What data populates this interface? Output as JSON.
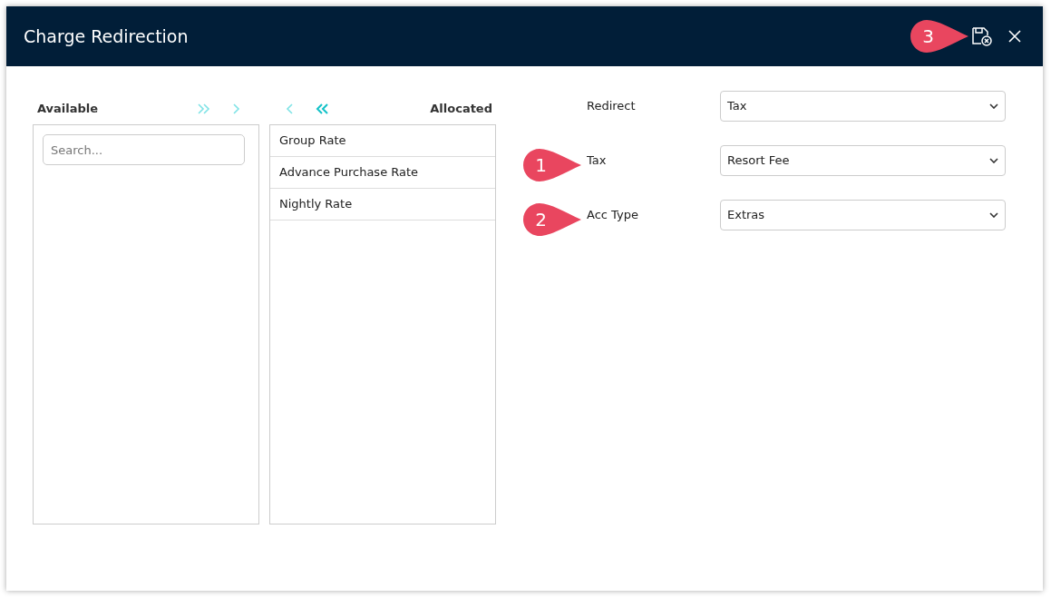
{
  "window": {
    "title": "Charge Redirection"
  },
  "available": {
    "title": "Available",
    "search": {
      "placeholder": "Search..."
    }
  },
  "transfer_buttons": [
    {
      "kind": "all-right",
      "enabled": false
    },
    {
      "kind": "right",
      "enabled": false
    },
    {
      "kind": "left",
      "enabled": false
    },
    {
      "kind": "all-left",
      "enabled": true
    }
  ],
  "allocated": {
    "title": "Allocated",
    "items": [
      "Group Rate",
      "Advance Purchase Rate",
      "Nightly Rate"
    ]
  },
  "form": [
    {
      "label": "Redirect",
      "value": "Tax"
    },
    {
      "label": "Tax",
      "value": "Resort Fee"
    },
    {
      "label": "Acc Type",
      "value": "Extras"
    }
  ],
  "callouts": [
    {
      "number": "1"
    },
    {
      "number": "2"
    },
    {
      "number": "3"
    }
  ]
}
